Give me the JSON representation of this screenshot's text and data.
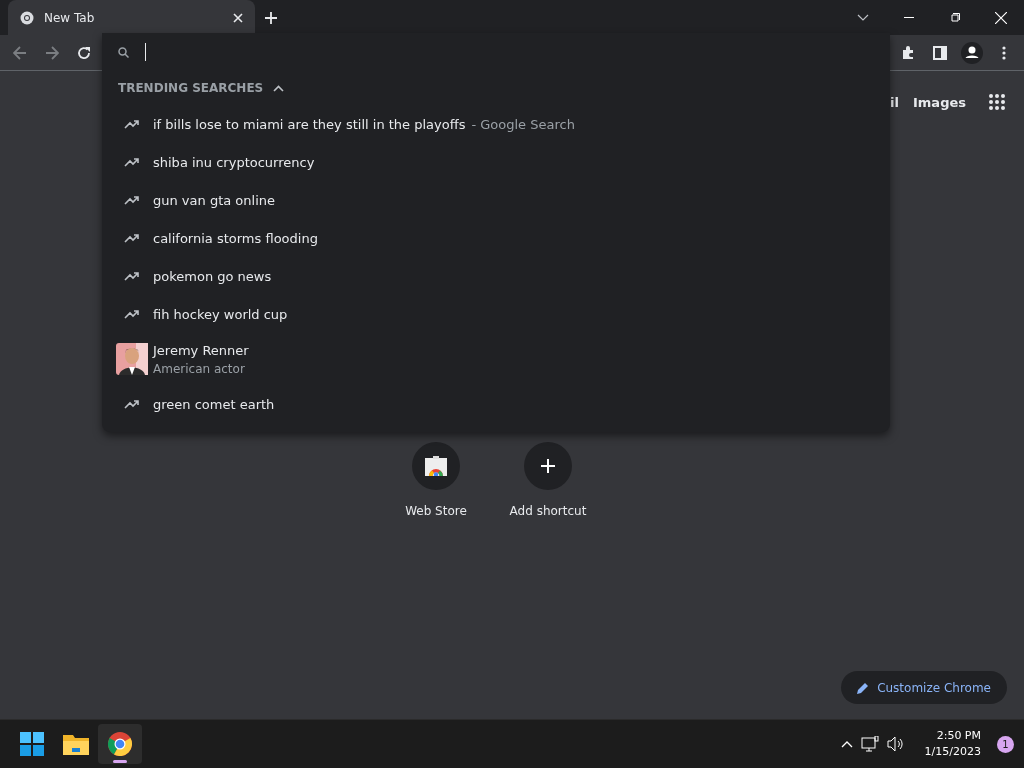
{
  "tabs": [
    {
      "title": "New Tab",
      "selected": true
    }
  ],
  "suggestions_header": {
    "label": "TRENDING SEARCHES",
    "expanded": true
  },
  "suggestions": [
    {
      "kind": "trend",
      "text": "if bills lose to miami are they still in the playoffs",
      "suffix": "- Google Search"
    },
    {
      "kind": "trend",
      "text": "shiba inu cryptocurrency"
    },
    {
      "kind": "trend",
      "text": "gun van gta online"
    },
    {
      "kind": "trend",
      "text": "california storms flooding"
    },
    {
      "kind": "trend",
      "text": "pokemon go news"
    },
    {
      "kind": "trend",
      "text": "fih hockey world cup"
    },
    {
      "kind": "entity",
      "text": "Jeremy Renner",
      "subtitle": "American actor"
    },
    {
      "kind": "trend",
      "text": "green comet earth"
    }
  ],
  "header_links": [
    "il",
    "Images"
  ],
  "shortcuts": [
    {
      "kind": "webstore",
      "label": "Web Store"
    },
    {
      "kind": "add",
      "label": "Add shortcut"
    }
  ],
  "customize_button": "Customize Chrome",
  "taskbar": {
    "apps": [
      {
        "kind": "start",
        "active": false
      },
      {
        "kind": "explorer",
        "active": false
      },
      {
        "kind": "chrome",
        "active": true
      }
    ],
    "time": "2:50 PM",
    "date": "1/15/2023",
    "notifications": "1"
  }
}
